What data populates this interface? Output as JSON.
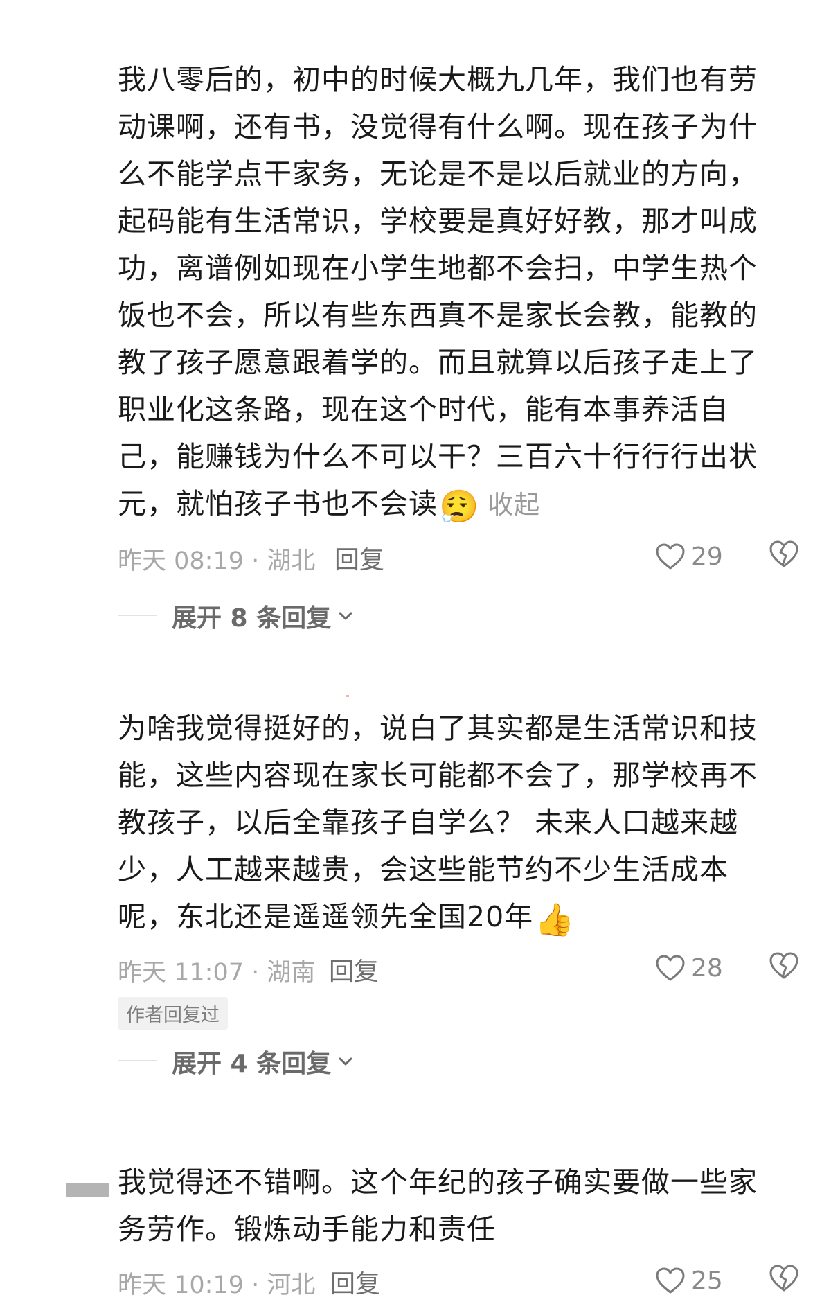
{
  "comments": [
    {
      "text": "我八零后的，初中的时候大概九几年，我们也有劳动课啊，还有书，没觉得有什么啊。现在孩子为什么不能学点干家务，无论是不是以后就业的方向，起码能有生活常识，学校要是真好好教，那才叫成功，离谱例如现在小学生地都不会扫，中学生热个饭也不会，所以有些东西真不是家长会教，能教的教了孩子愿意跟着学的。而且就算以后孩子走上了职业化这条路，现在这个时代，能有本事养活自己，能赚钱为什么不可以干？三百六十行行行出状元，就怕孩子书也不会读",
      "emoji": "😮‍💨",
      "emoji_name": "sigh-face",
      "collapse_label": "收起",
      "time_location": "昨天 08:19 · 湖北",
      "reply_label": "回复",
      "like_count": "29",
      "author_replied": "",
      "expand_label": "展开 8 条回复"
    },
    {
      "text": "为啥我觉得挺好的，说白了其实都是生活常识和技能，这些内容现在家长可能都不会了，那学校再不教孩子，以后全靠孩子自学么？ 未来人口越来越少，人工越来越贵，会这些能节约不少生活成本呢，东北还是遥遥领先全国20年",
      "emoji": "👍",
      "emoji_name": "thumbs-up",
      "collapse_label": "",
      "time_location": "昨天 11:07 · 湖南",
      "reply_label": "回复",
      "like_count": "28",
      "author_replied": "作者回复过",
      "expand_label": "展开 4 条回复"
    },
    {
      "text": "我觉得还不错啊。这个年纪的孩子确实要做一些家务劳作。锻炼动手能力和责任",
      "emoji": "",
      "emoji_name": "",
      "collapse_label": "",
      "time_location": "昨天 10:19 · 河北",
      "reply_label": "回复",
      "like_count": "25",
      "author_replied": "",
      "expand_label": ""
    }
  ],
  "icons": {
    "like": "heart-outline-icon",
    "dislike": "broken-heart-icon",
    "expand": "chevron-down-icon"
  },
  "colors": {
    "text": "#1a1a1a",
    "meta": "#a8a8a8",
    "reply": "#6e6e6e",
    "icon": "#7a7a7a"
  }
}
